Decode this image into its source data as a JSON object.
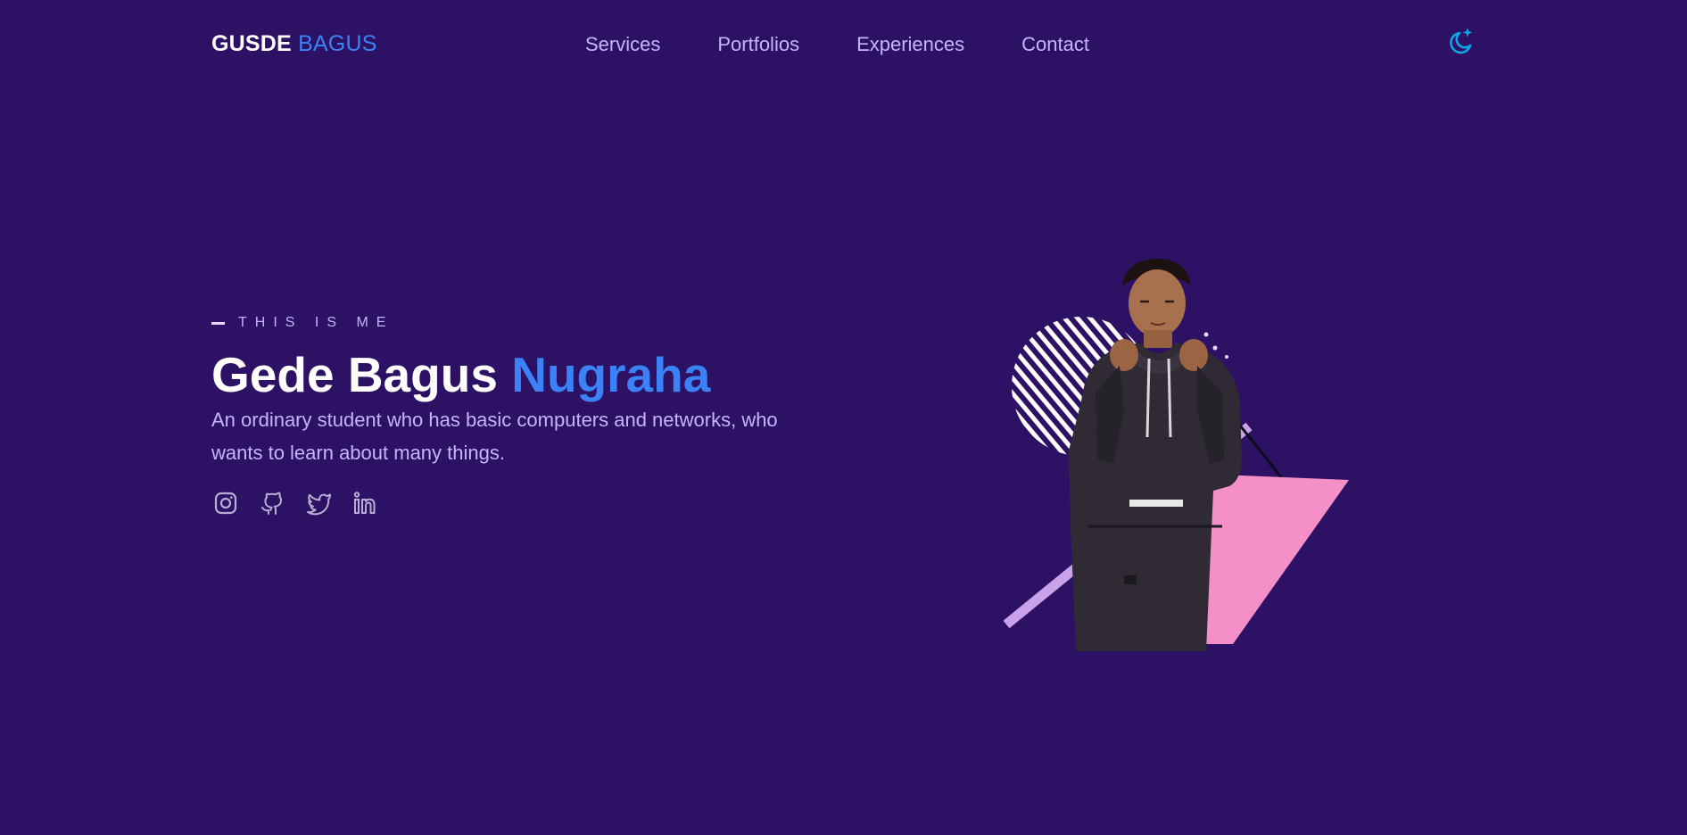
{
  "nav": {
    "logo_first": "GUSDE",
    "logo_second": "BAGUS",
    "links": [
      "Services",
      "Portfolios",
      "Experiences",
      "Contact"
    ],
    "theme_icon": "moon-star-icon"
  },
  "hero": {
    "tagline": "THIS IS ME",
    "name_first": "Gede Bagus ",
    "name_accent": "Nugraha",
    "description": "An ordinary student who has basic computers and networks, who wants to learn about many things.",
    "social_icons": [
      "instagram-icon",
      "github-icon",
      "twitter-icon",
      "linkedin-icon"
    ]
  },
  "colors": {
    "background": "#2d1164",
    "accent": "#3b82f6",
    "text_muted": "#c4b5fd",
    "pink": "#f48fc8",
    "lavender": "#c9a2ea"
  }
}
